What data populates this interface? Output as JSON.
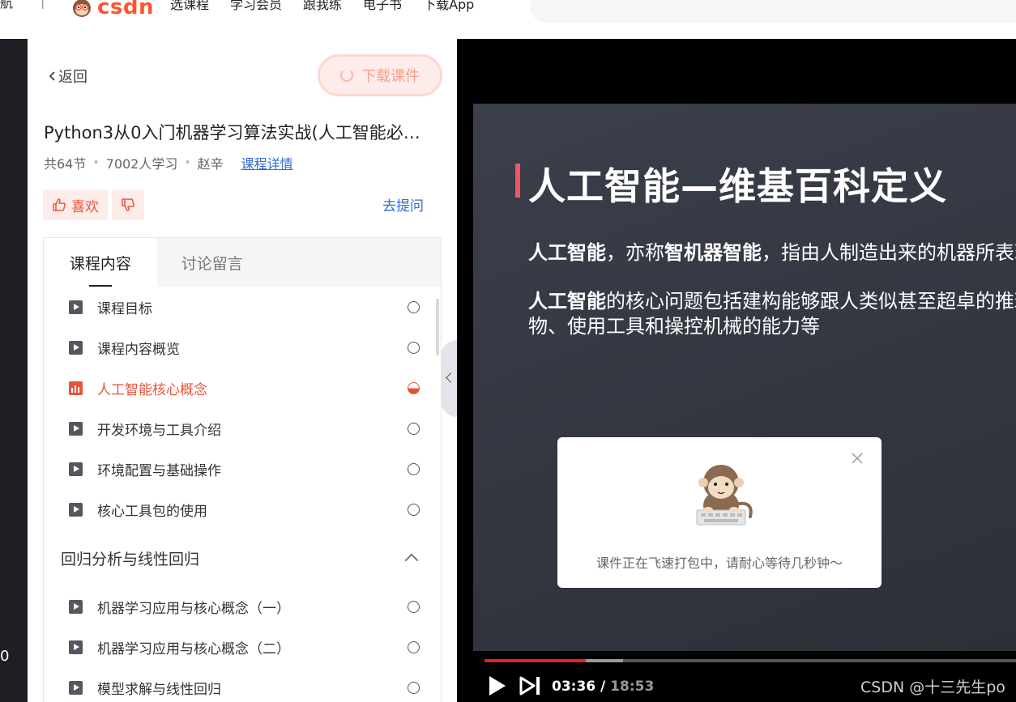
{
  "nav": {
    "cut_left": "航",
    "separator": "|",
    "logo_text": "CSDN",
    "links": [
      "选课程",
      "学习会员",
      "跟我练",
      "电子书",
      "下载App"
    ]
  },
  "left_strip": {
    "number": "0"
  },
  "panel": {
    "back_label": "返回",
    "download_label": "下载课件",
    "course_title": "Python3从0入门机器学习算法实战(人工智能必…",
    "meta": {
      "lessons": "共64节",
      "learners": "7002人学习",
      "teacher": "赵辛",
      "detail_link": "课程详情"
    },
    "like_label": "喜欢",
    "ask_label": "去提问",
    "tabs": [
      {
        "label": "课程内容",
        "active": true
      },
      {
        "label": "讨论留言",
        "active": false
      }
    ],
    "items_top": [
      {
        "label": "课程目标",
        "status": "none"
      },
      {
        "label": "课程内容概览",
        "status": "none"
      },
      {
        "label": "人工智能核心概念",
        "status": "playing"
      },
      {
        "label": "开发环境与工具介绍",
        "status": "none"
      },
      {
        "label": "环境配置与基础操作",
        "status": "none"
      },
      {
        "label": "核心工具包的使用",
        "status": "none"
      }
    ],
    "section": "回归分析与线性回归",
    "items_bottom": [
      {
        "label": "机器学习应用与核心概念（一）",
        "status": "none"
      },
      {
        "label": "机器学习应用与核心概念（二）",
        "status": "none"
      },
      {
        "label": "模型求解与线性回归",
        "status": "none"
      }
    ]
  },
  "video": {
    "slide_title": "人工智能—维基百科定义",
    "p1_b1": "人工智能",
    "p1_t1": "，亦称",
    "p1_b2": "智机器智能",
    "p1_t2": "，指由人制造出来的机器所表现出来的智能",
    "p2_b1": "人工智能",
    "p2_t1": "的核心问题包括建构能够跟人类似甚至超卓的推理、知识、规划、学习、交流、感知、移",
    "p2_line2": "物、使用工具和操控机械的能力等",
    "toast_text": "课件正在飞速打包中，请耐心等待几秒钟～",
    "time_current": "03:36 /",
    "time_total": "18:53",
    "played_fraction": 0.19,
    "buffered_fraction": 0.26,
    "watermark": "CSDN @十三先生po"
  },
  "colors": {
    "brand": "#fc5531",
    "accent_red": "#e6543c",
    "link": "#2d6bd6",
    "progress": "#e32222"
  }
}
